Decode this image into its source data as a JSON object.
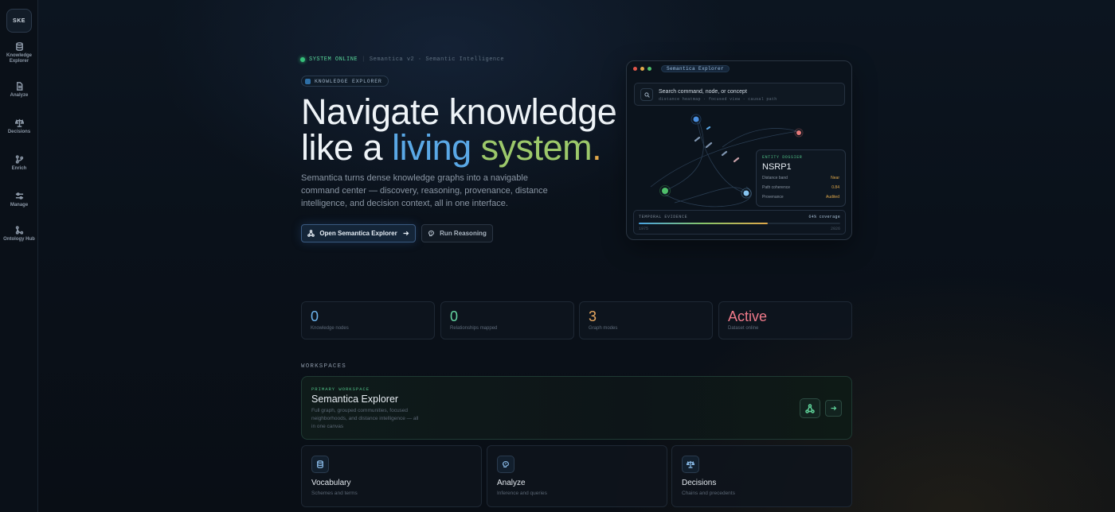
{
  "sidebar": {
    "logo": "SKE",
    "items": [
      {
        "label": "Knowledge Explorer",
        "icon": "database-icon"
      },
      {
        "label": "Analyze",
        "icon": "document-icon"
      },
      {
        "label": "Decisions",
        "icon": "scale-icon"
      },
      {
        "label": "Enrich",
        "icon": "git-branch-icon"
      },
      {
        "label": "Manage",
        "icon": "sliders-icon"
      },
      {
        "label": "Ontology Hub",
        "icon": "git-merge-icon"
      }
    ]
  },
  "status": {
    "online": "SYSTEM ONLINE",
    "version": "Semantica v2 · Semantic Intelligence"
  },
  "badge": "KNOWLEDGE EXPLORER",
  "hero": {
    "line1": "Navigate knowledge",
    "line2_a": "like a",
    "line2_living": "living",
    "line2_system": "system",
    "line2_period": "."
  },
  "description": "Semantica turns dense knowledge graphs into a navigable command center — discovery, reasoning, provenance, distance intelligence, and decision context, all in one interface.",
  "buttons": {
    "primary": "Open Semantica Explorer",
    "secondary": "Run Reasoning"
  },
  "preview": {
    "title": "Semantica Explorer",
    "search_placeholder": "Search command, node, or concept",
    "search_hint": "distance heatmap · focused view · causal path",
    "dossier": {
      "label": "ENTITY DOSSIER",
      "entity": "NSRP1",
      "rows": [
        {
          "key": "Distance band",
          "value": "Near"
        },
        {
          "key": "Path coherence",
          "value": "0.84"
        },
        {
          "key": "Provenance",
          "value": "Audited"
        }
      ]
    },
    "temporal": {
      "label": "TEMPORAL EVIDENCE",
      "coverage": "64% coverage",
      "coverage_fraction": 0.64,
      "start": "1975",
      "end": "2026"
    }
  },
  "stats": [
    {
      "value": "0",
      "label": "Knowledge nodes",
      "color": "#6cb4ee"
    },
    {
      "value": "0",
      "label": "Relationships mapped",
      "color": "#64d3a0"
    },
    {
      "value": "3",
      "label": "Graph modes",
      "color": "#e8a860"
    },
    {
      "value": "Active",
      "label": "Dataset online",
      "color": "#f07a8a"
    }
  ],
  "workspaces": {
    "heading": "WORKSPACES",
    "primary": {
      "kicker": "PRIMARY WORKSPACE",
      "title": "Semantica Explorer",
      "description": "Full graph, grouped communities, focused neighborhoods, and distance intelligence — all in one canvas"
    },
    "cards": [
      {
        "title": "Vocabulary",
        "subtitle": "Schemes and terms",
        "icon": "database-icon"
      },
      {
        "title": "Analyze",
        "subtitle": "Inference and queries",
        "icon": "brain-icon"
      },
      {
        "title": "Decisions",
        "subtitle": "Chains and precedents",
        "icon": "scale-icon"
      }
    ]
  },
  "colors": {
    "accent_blue": "#5aa8e6",
    "accent_green": "#9cc86a",
    "accent_amber": "#e0a84a",
    "status_green": "#36c07a"
  }
}
